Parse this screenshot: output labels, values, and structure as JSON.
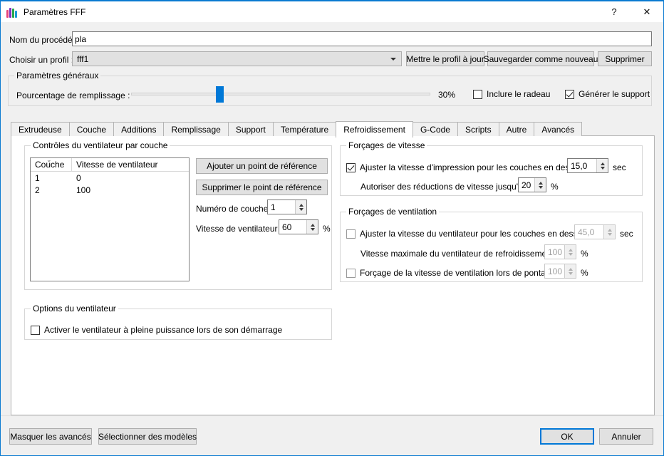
{
  "window": {
    "title": "Paramètres FFF",
    "icon": "app-bars-icon",
    "help_button": "?",
    "close_button": "✕",
    "accent_color": "#0a7ad1"
  },
  "form": {
    "process_name_label": "Nom du procédé :",
    "process_name_value": "pla",
    "profile_label": "Choisir un profil :",
    "profile_value": "fff1",
    "update_profile_button": "Mettre le profil à jour",
    "save_as_new_button": "Sauvegarder comme nouveau",
    "delete_button": "Supprimer"
  },
  "general": {
    "group_title": "Paramètres généraux",
    "infill_label": "Pourcentage de remplissage :",
    "infill_value": "30%",
    "infill_percent": 30,
    "raft_checkbox_label": "Inclure le radeau",
    "raft_checked": false,
    "support_checkbox_label": "Générer le support",
    "support_checked": true
  },
  "tabs": {
    "items": [
      {
        "label": "Extrudeuse",
        "active": false
      },
      {
        "label": "Couche",
        "active": false
      },
      {
        "label": "Additions",
        "active": false
      },
      {
        "label": "Remplissage",
        "active": false
      },
      {
        "label": "Support",
        "active": false
      },
      {
        "label": "Température",
        "active": false
      },
      {
        "label": "Refroidissement",
        "active": true
      },
      {
        "label": "G-Code",
        "active": false
      },
      {
        "label": "Scripts",
        "active": false
      },
      {
        "label": "Autre",
        "active": false
      },
      {
        "label": "Avancés",
        "active": false
      }
    ]
  },
  "fan_controls": {
    "group_title": "Contrôles du ventilateur par couche",
    "table": {
      "columns": [
        "Couche",
        "Vitesse de ventilateur"
      ],
      "sort_indicator": "⌄",
      "rows": [
        {
          "layer": "1",
          "speed": "0"
        },
        {
          "layer": "2",
          "speed": "100"
        }
      ]
    },
    "add_setpoint_button": "Ajouter un point de référence",
    "remove_setpoint_button": "Supprimer le point de référence",
    "layer_number_label": "Numéro de couche",
    "layer_number_value": "1",
    "fan_speed_label": "Vitesse de ventilateur",
    "fan_speed_value": "60",
    "fan_speed_unit": "%"
  },
  "speed_overrides": {
    "group_title": "Forçages de vitesse",
    "adjust_print_speed_label": "Ajuster la vitesse d'impression pour les couches en dessous",
    "adjust_print_speed_checked": true,
    "adjust_print_speed_value": "15,0",
    "adjust_print_speed_unit": "sec",
    "allow_reduction_label": "Autoriser des réductions de vitesse jusqu'à",
    "allow_reduction_value": "20",
    "allow_reduction_unit": "%"
  },
  "fan_overrides": {
    "group_title": "Forçages de ventilation",
    "adjust_fan_speed_label": "Ajuster la vitesse du ventilateur pour les couches en dessous",
    "adjust_fan_speed_checked": false,
    "adjust_fan_speed_value": "45,0",
    "adjust_fan_speed_unit": "sec",
    "max_fan_speed_label": "Vitesse maximale du ventilateur de refroidissement",
    "max_fan_speed_value": "100",
    "max_fan_speed_unit": "%",
    "bridging_fan_label": "Forçage de la vitesse de ventilation lors de pontage",
    "bridging_fan_checked": false,
    "bridging_fan_value": "100",
    "bridging_fan_unit": "%"
  },
  "fan_options": {
    "group_title": "Options du ventilateur",
    "blip_fan_label": "Activer le ventilateur à pleine puissance lors de son démarrage",
    "blip_fan_checked": false
  },
  "footer": {
    "hide_advanced_button": "Masquer les avancés",
    "select_models_button": "Sélectionner des modèles",
    "ok_button": "OK",
    "cancel_button": "Annuler"
  }
}
